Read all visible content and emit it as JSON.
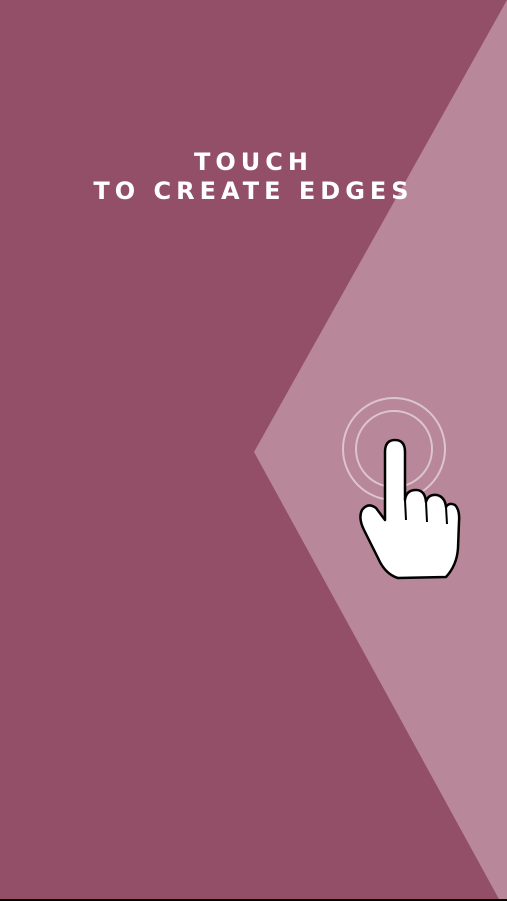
{
  "instruction": {
    "line1": "TOUCH",
    "line2": "TO  CREATE  EDGES"
  },
  "colors": {
    "background": "#934f68",
    "edge_region": "#b88799",
    "text": "#ffffff"
  },
  "icons": {
    "tap_hint": "hand-pointer-icon",
    "tap_ripple": "tap-ripple-icon"
  }
}
